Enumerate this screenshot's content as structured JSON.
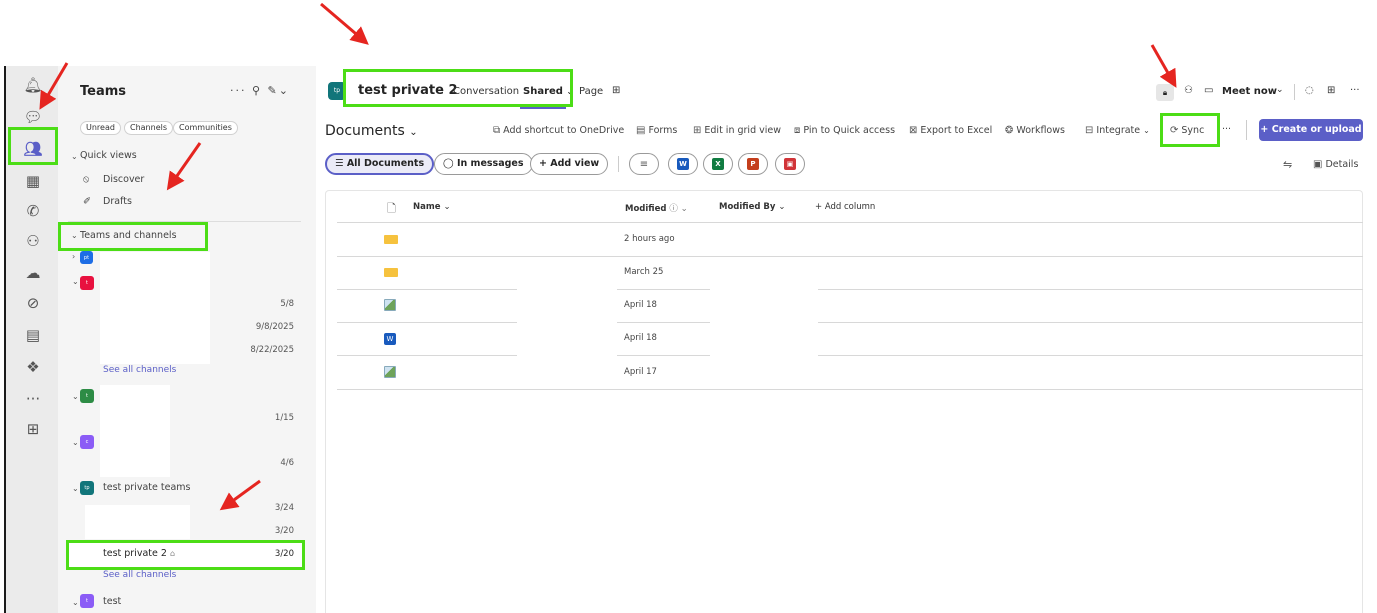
{
  "rail": {
    "items": [
      {
        "icon": "bell-icon",
        "glyph": "🔔︎",
        "name": "activity"
      },
      {
        "icon": "chat-icon",
        "glyph": "💬︎",
        "name": "chat"
      },
      {
        "icon": "teams-icon",
        "glyph": "👥︎",
        "name": "teams"
      },
      {
        "icon": "calendar-icon",
        "glyph": "▦",
        "name": "calendar"
      },
      {
        "icon": "phone-icon",
        "glyph": "✆",
        "name": "calls"
      },
      {
        "icon": "people-icon",
        "glyph": "⚇",
        "name": "people"
      },
      {
        "icon": "cloud-icon",
        "glyph": "☁︎",
        "name": "onedrive"
      },
      {
        "icon": "copilot-icon",
        "glyph": "⊘",
        "name": "copilot"
      },
      {
        "icon": "planner-icon",
        "glyph": "▤",
        "name": "planner"
      },
      {
        "icon": "app-icon",
        "glyph": "❖",
        "name": "app"
      },
      {
        "icon": "more-icon",
        "glyph": "···",
        "name": "more-apps"
      },
      {
        "icon": "add-icon",
        "glyph": "⊞",
        "name": "add-apps"
      }
    ]
  },
  "left": {
    "title": "Teams",
    "tools": "···  ⚲  ✎⌄",
    "filters": [
      "Unread",
      "Channels",
      "Communities"
    ],
    "quick_views": "Quick views",
    "discover": "Discover",
    "discover_icon": "⦸",
    "drafts": "Drafts",
    "drafts_icon": "✐",
    "teams_and_channels": "Teams and channels",
    "dates": [
      "5/8",
      "9/8/2025",
      "8/22/2025",
      "1/15",
      "4/6",
      "3/24",
      "3/20"
    ],
    "see_all_1": "See all channels",
    "team_private": "test private teams",
    "selected_channel": "test private 2",
    "selected_date": "3/20",
    "see_all_2": "See all channels",
    "team_test": "test",
    "team_initials": [
      "pt",
      "t",
      "t",
      "c",
      "tp",
      "t"
    ],
    "team_colors": [
      "#1d6de5",
      "#e8113f",
      "#2d8c45",
      "#8b5cf6",
      "#11757a",
      "#8b5cf6"
    ]
  },
  "header": {
    "avatar": "tp",
    "avatar_color": "#11757a",
    "title": "test private 2",
    "tabs": [
      "Conversation",
      "Shared",
      "Page"
    ],
    "shared_chevron": "⌄",
    "add_tab": "⊞",
    "lock_icon": "🔒︎",
    "people_icon": "⚇",
    "video_icon": "▭",
    "meet_now": "Meet now",
    "meet_chevron": "⌄",
    "chat_icon": "◌",
    "apps_icon": "⊞",
    "more": "···"
  },
  "toolbar": {
    "documents": "Documents",
    "documents_chevron": "⌄",
    "add_shortcut": "Add shortcut to OneDrive",
    "forms": "Forms",
    "edit_grid": "Edit in grid view",
    "pin_quick": "Pin to Quick access",
    "export_excel": "Export to Excel",
    "workflows": "Workflows",
    "integrate": "Integrate",
    "sync": "Sync",
    "more": "···",
    "create_upload": "Create or upload"
  },
  "views": {
    "all_documents": "All Documents",
    "in_messages": "In messages",
    "add_view": "Add view",
    "filter_icon": "≡",
    "details": "Details"
  },
  "formats": [
    {
      "letter": "W",
      "color": "#185abd",
      "name": "word-filter-icon"
    },
    {
      "letter": "X",
      "color": "#107c41",
      "name": "excel-filter-icon"
    },
    {
      "letter": "P",
      "color": "#c43e1c",
      "name": "powerpoint-filter-icon"
    },
    {
      "letter": "▣",
      "color": "#d13438",
      "name": "pdf-filter-icon"
    }
  ],
  "columns": {
    "name": "Name",
    "modified": "Modified",
    "modified_by": "Modified By",
    "add_column": "Add column"
  },
  "rows": [
    {
      "type": "folder",
      "modified": "2 hours ago"
    },
    {
      "type": "folder",
      "modified": "March 25"
    },
    {
      "type": "image",
      "modified": "April 18"
    },
    {
      "type": "word",
      "modified": "April 18"
    },
    {
      "type": "image",
      "modified": "April 17"
    }
  ],
  "colors": {
    "accent": "#5b5fc7",
    "highlight": "#4cdd16",
    "arrow": "#e52520"
  }
}
